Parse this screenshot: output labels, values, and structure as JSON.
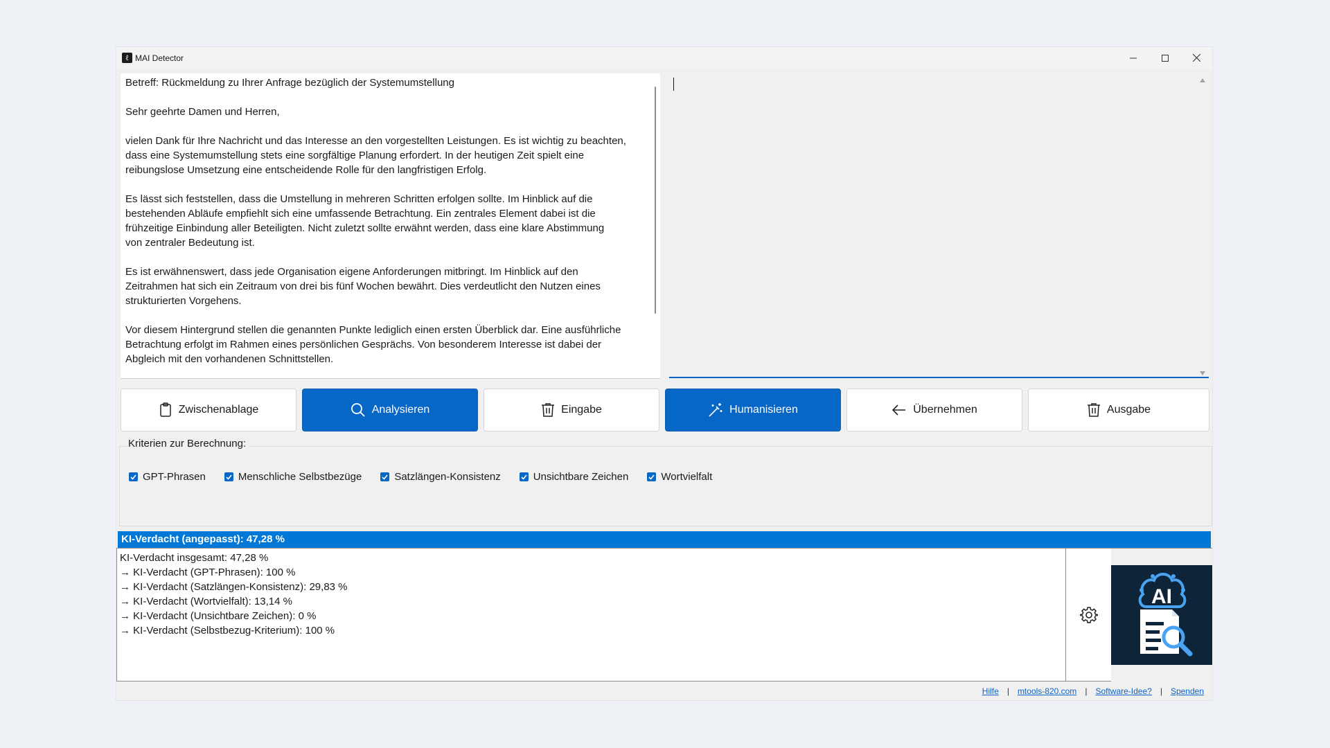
{
  "window": {
    "title": "MAI Detector",
    "app_icon_glyph": "ℓ"
  },
  "input": {
    "text": "Betreff: Rückmeldung zu Ihrer Anfrage bezüglich der Systemumstellung\n\nSehr geehrte Damen und Herren,\n\nvielen Dank für Ihre Nachricht und das Interesse an den vorgestellten Leistungen. Es ist wichtig zu beachten,\ndass eine Systemumstellung stets eine sorgfältige Planung erfordert. In der heutigen Zeit spielt eine\nreibungslose Umsetzung eine entscheidende Rolle für den langfristigen Erfolg.\n\nEs lässt sich feststellen, dass die Umstellung in mehreren Schritten erfolgen sollte. Im Hinblick auf die\nbestehenden Abläufe empfiehlt sich eine umfassende Betrachtung. Ein zentrales Element dabei ist die\nfrühzeitige Einbindung aller Beteiligten. Nicht zuletzt sollte erwähnt werden, dass eine klare Abstimmung\nvon zentraler Bedeutung ist.\n\nEs ist erwähnenswert, dass jede Organisation eigene Anforderungen mitbringt. Im Hinblick auf den\nZeitrahmen hat sich ein Zeitraum von drei bis fünf Wochen bewährt. Dies verdeutlicht den Nutzen eines\nstrukturierten Vorgehens.\n\nVor diesem Hintergrund stellen die genannten Punkte lediglich einen ersten Überblick dar. Eine ausführliche\nBetrachtung erfolgt im Rahmen eines persönlichen Gesprächs. Von besonderem Interesse ist dabei der\nAbgleich mit den vorhandenen Schnittstellen."
  },
  "output": {
    "text": ""
  },
  "buttons": {
    "clipboard": {
      "label": "Zwischenablage",
      "icon": "clipboard-icon"
    },
    "analyze": {
      "label": "Analysieren",
      "icon": "search-icon"
    },
    "clear_input": {
      "label": "Eingabe",
      "icon": "trash-icon"
    },
    "humanize": {
      "label": "Humanisieren",
      "icon": "magic-wand-icon"
    },
    "apply": {
      "label": "Übernehmen",
      "icon": "arrow-left-icon"
    },
    "clear_output": {
      "label": "Ausgabe",
      "icon": "trash-icon"
    }
  },
  "criteria": {
    "title": "Kriterien zur Berechnung:",
    "items": [
      {
        "label": "GPT-Phrasen",
        "checked": true
      },
      {
        "label": "Menschliche Selbstbezüge",
        "checked": true
      },
      {
        "label": "Satzlängen-Konsistenz",
        "checked": true
      },
      {
        "label": "Unsichtbare Zeichen",
        "checked": true
      },
      {
        "label": "Wortvielfalt",
        "checked": true
      }
    ]
  },
  "result": {
    "headline": "KI-Verdacht (angepasst): 47,28 %",
    "lines": [
      "KI-Verdacht insgesamt: 47,28 %",
      "→ KI-Verdacht (GPT-Phrasen): 100 %",
      "→ KI-Verdacht (Satzlängen-Konsistenz): 29,83 %",
      "→ KI-Verdacht (Wortvielfalt): 13,14 %",
      "→ KI-Verdacht (Unsichtbare Zeichen): 0 %",
      "→ KI-Verdacht (Selbstbezug-Kriterium): 100 %"
    ]
  },
  "logo": {
    "text": "AI"
  },
  "footer": {
    "links": [
      "Hilfe",
      "mtools-820.com",
      "Software-Idee?",
      "Spenden"
    ],
    "separator": "|"
  },
  "colors": {
    "primary": "#0767c6",
    "result_bar": "#0078d7",
    "logo_bg": "#0e2438",
    "link": "#0a64c8"
  }
}
